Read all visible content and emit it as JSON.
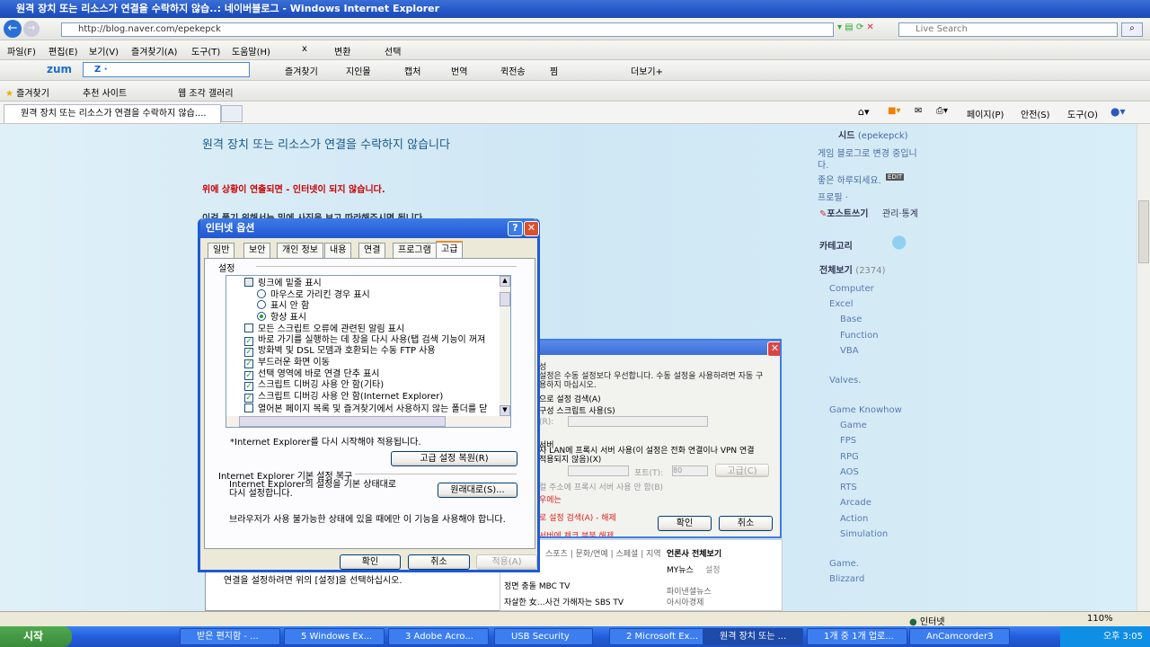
{
  "window": {
    "title": "원격 장치 또는 리소스가 연결을 수락하지 않습..: 네이버블로그 - Windows Internet Explorer"
  },
  "address": {
    "url": "http://blog.naver.com/epekepck",
    "search_placeholder": "Live Search"
  },
  "menu": [
    "파일(F)",
    "편집(E)",
    "보기(V)",
    "즐겨찾기(A)",
    "도구(T)",
    "도움말(H)"
  ],
  "menu_extra": {
    "close": "x",
    "convert": "변환",
    "select": "선택"
  },
  "zum": {
    "logo": "zum",
    "input": "Z  ·",
    "items": [
      "즐겨찾기",
      "지인몰",
      "캡처",
      "번역",
      "퀵전송",
      "찜",
      "더보기+"
    ]
  },
  "favbar": {
    "favorites": "즐겨찾기",
    "items": [
      "추천 사이트",
      "웹 조각 갤러리"
    ]
  },
  "tab": {
    "title": "원격 장치 또는 리소스가 연결을 수락하지 않습...."
  },
  "cmdbar": [
    "페이지(P)",
    "안전(S)",
    "도구(O)"
  ],
  "post": {
    "title": "원격 장치 또는 리소스가 연결을 수락하지 않습니다",
    "red_line": "위에 상황이 연출되면 - 인터넷이 되지 않습니다.",
    "line2": "이걸 풀기 위해서는 밑에 사진을 보고 따라해주시면 됩니다",
    "bottom_text": "연결을 설정하려면 위의 [설정]을 선택하십시오."
  },
  "sidebar": {
    "name": "시드",
    "id": "(epekepck)",
    "intro": "게임 블로그로 변경 중입니다.",
    "greet": "좋은 하루되세요.",
    "edit": "EDIT",
    "profile": "프로필 ·",
    "write": "포스트쓰기",
    "manage": "관리·통계",
    "category_title": "카테고리",
    "all": "전체보기",
    "all_count": "(2374)",
    "categories": [
      {
        "label": "Computer",
        "sub": false
      },
      {
        "label": "Excel",
        "sub": false
      },
      {
        "label": "Base",
        "sub": true
      },
      {
        "label": "Function",
        "sub": true
      },
      {
        "label": "VBA",
        "sub": true
      },
      {
        "label": "Valves.",
        "sub": false
      },
      {
        "label": "Game Knowhow",
        "sub": false
      },
      {
        "label": "Game",
        "sub": true
      },
      {
        "label": "FPS",
        "sub": true
      },
      {
        "label": "RPG",
        "sub": true
      },
      {
        "label": "AOS",
        "sub": true
      },
      {
        "label": "RTS",
        "sub": true
      },
      {
        "label": "Arcade",
        "sub": true
      },
      {
        "label": "Action",
        "sub": true
      },
      {
        "label": "Simulation",
        "sub": true
      },
      {
        "label": "Game.",
        "sub": false
      },
      {
        "label": "Blizzard",
        "sub": false
      }
    ]
  },
  "dialog": {
    "title": "인터넷 옵션",
    "tabs": [
      "일반",
      "보안",
      "개인 정보",
      "내용",
      "연결",
      "프로그램",
      "고급"
    ],
    "active_tab": "고급",
    "group_settings": "설정",
    "settings": [
      {
        "type": "group",
        "label": "링크에 밑줄 표시"
      },
      {
        "type": "radio",
        "checked": false,
        "label": "마우스로 가리킨 경우 표시"
      },
      {
        "type": "radio",
        "checked": false,
        "label": "표시 안 함"
      },
      {
        "type": "radio",
        "checked": true,
        "label": "항상 표시"
      },
      {
        "type": "checkbox",
        "checked": false,
        "label": "모든 스크립트 오류에 관련된 알림 표시"
      },
      {
        "type": "checkbox",
        "checked": true,
        "label": "바로 가기를 실행하는 데 창을 다시 사용(탭 검색 기능이 꺼져"
      },
      {
        "type": "checkbox",
        "checked": true,
        "label": "방화벽 및 DSL 모뎀과 호환되는 수동 FTP 사용"
      },
      {
        "type": "checkbox",
        "checked": true,
        "label": "부드러운 화면 이동"
      },
      {
        "type": "checkbox",
        "checked": true,
        "label": "선택 영역에 바로 연결 단추 표시"
      },
      {
        "type": "checkbox",
        "checked": true,
        "label": "스크립트 디버깅 사용 안 함(기타)"
      },
      {
        "type": "checkbox",
        "checked": true,
        "label": "스크립트 디버깅 사용 안 함(Internet Explorer)"
      },
      {
        "type": "checkbox",
        "checked": false,
        "label": "열어본 페이지 목록 및 즐겨찾기에서 사용하지 않는 폴더를 닫"
      }
    ],
    "restart_note": "*Internet Explorer를 다시 시작해야 적용됩니다.",
    "restore_advanced": "고급 설정 복원(R)",
    "reset_group": "Internet Explorer 기본 설정 복구",
    "reset_desc": "Internet Explorer의 설정을 기본 상태대로 다시 설정합니다.",
    "reset_button": "원래대로(S)...",
    "reset_warning": "브라우저가 사용 불가능한 상태에 있을 때에만 이 기능을 사용해야 합니다.",
    "ok": "확인",
    "cancel": "취소",
    "apply": "적용(A)"
  },
  "lan": {
    "l1": "성",
    "l2": "설정은 수동 설정보다 우선합니다. 수동 설정을 사용하려면 자동 구",
    "l3": "용하지 마십시오.",
    "auto": "으로 설정 검색(A)",
    "script": "구성 스크립트 사용(S)",
    "addr": "(R):",
    "proxy": "서버",
    "proxy_use": "자 LAN에 프록시 서버 사용(이 설정은 전화 연결이나 VPN 연결",
    "proxy_use2": "적용되지 않음)(X)",
    "port_label": "포트(T):",
    "port": "80",
    "advanced": "고급(C)",
    "bypass": "컬 주소에 프록시 서버 사용 안 함(B)",
    "red1": "우에는",
    "red2": "로 설정 검색(A) - 해제",
    "red3": "서버에 체크 부분 해제",
    "ok": "확인",
    "cancel": "취소"
  },
  "news": {
    "tabs": "스포츠 | 문화/연예 | 스페셜 | 지역",
    "press": "언론사 전체보기",
    "my": "MY뉴스",
    "set": "설정",
    "h1": "정면 충돌 MBC TV",
    "h2": "자살한 女…사건 가해자는 SBS TV",
    "p1": "파이낸셜뉴스",
    "p2": "아시아경제"
  },
  "status": {
    "zone": "인터넷",
    "zoom": "110%"
  },
  "taskbar": {
    "start": "시작",
    "items": [
      "받은 편지함 - ...",
      "5 Windows Ex...",
      "3 Adobe Acro...",
      "USB Security",
      "2 Microsoft Ex...",
      "원격 장치 또는 ...",
      "1개 중 1개 업로...",
      "AnCamcorder3"
    ],
    "active": 5,
    "clock": "오후 3:05"
  },
  "colors": {
    "title_blue": "#2456c6",
    "red_text": "#cc0000",
    "post_title": "#1a5a8a",
    "taskbar": "#245edb"
  }
}
